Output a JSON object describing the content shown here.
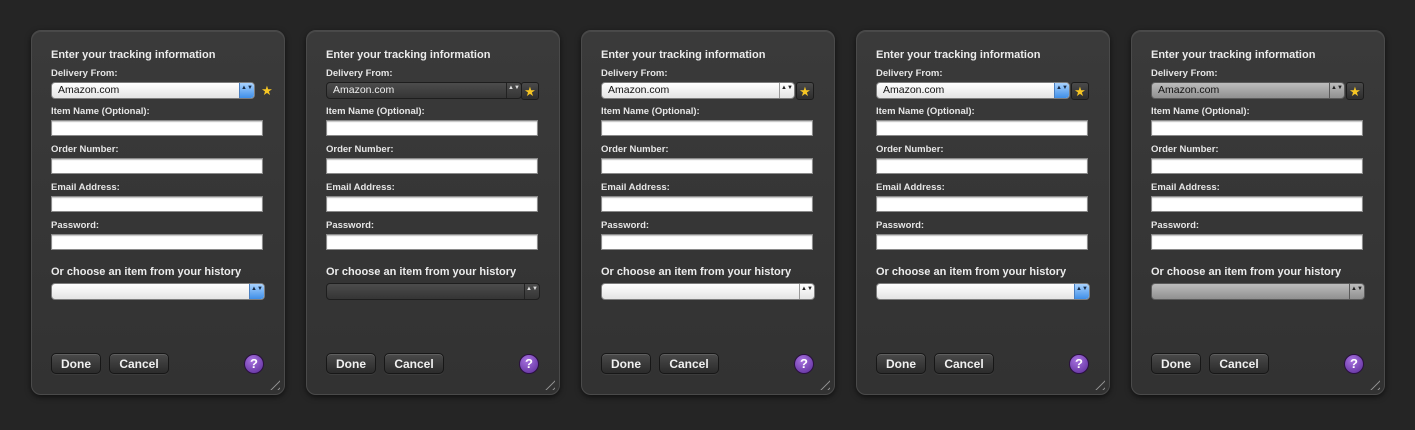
{
  "form": {
    "title": "Enter your tracking information",
    "delivery_from_label": "Delivery From:",
    "delivery_from_value": "Amazon.com",
    "item_name_label": "Item Name (Optional):",
    "order_number_label": "Order Number:",
    "email_label": "Email Address:",
    "password_label": "Password:",
    "history_label": "Or choose an item from your history",
    "done_label": "Done",
    "cancel_label": "Cancel",
    "help_label": "?",
    "star_glyph": "★",
    "arrows_glyph": "▲▼"
  },
  "panels": [
    {
      "theme": "aqua-light"
    },
    {
      "theme": "dark"
    },
    {
      "theme": "graphite-light"
    },
    {
      "theme": "aqua-light-boxed"
    },
    {
      "theme": "gray"
    }
  ],
  "icons": {
    "star": "star-icon",
    "help": "question-mark-icon",
    "resize": "resize-grip-icon"
  },
  "colors": {
    "background": "#252525",
    "panel": "#363636",
    "star": "#f6c624",
    "help": "#7a45c0",
    "aqua": "#3f8fe8"
  }
}
